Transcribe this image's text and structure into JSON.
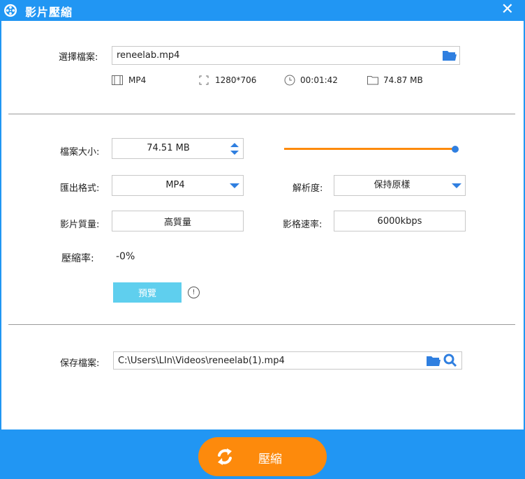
{
  "window": {
    "title": "影片壓縮",
    "close_symbol": "✕"
  },
  "source": {
    "label": "選擇檔案:",
    "file_value": "reneelab.mp4",
    "format": "MP4",
    "resolution": "1280*706",
    "duration": "00:01:42",
    "size": "74.87 MB"
  },
  "settings": {
    "filesize_label": "檔案大小:",
    "filesize_value": "74.51 MB",
    "filesize_slider_fraction": 1.0,
    "format_label": "匯出格式:",
    "format_value": "MP4",
    "resolution_label": "解析度:",
    "resolution_value": "保持原樣",
    "quality_label": "影片質量:",
    "quality_value": "高質量",
    "bitrate_label": "影格速率:",
    "bitrate_value": "6000kbps",
    "ratio_label": "壓縮率:",
    "ratio_value": "-0%",
    "preview_label": "預覽",
    "info_symbol": "!"
  },
  "output": {
    "label": "保存檔案:",
    "path_value": "C:\\Users\\LIn\\Videos\\reneelab(1).mp4"
  },
  "footer": {
    "compress_label": "壓縮"
  },
  "colors": {
    "accent_blue": "#2196f3",
    "orange": "#fd8a0c",
    "preview_button": "#5fcfee",
    "icon_blue": "#2f7fe0"
  }
}
